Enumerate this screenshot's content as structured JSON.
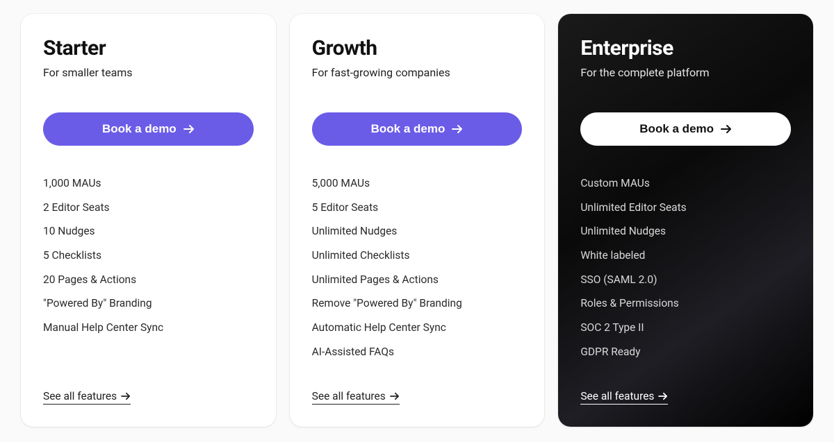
{
  "plans": [
    {
      "title": "Starter",
      "subtitle": "For smaller teams",
      "cta": "Book a demo",
      "features": [
        "1,000 MAUs",
        "2 Editor Seats",
        "10 Nudges",
        "5 Checklists",
        "20 Pages & Actions",
        "\"Powered By\" Branding",
        "Manual Help Center Sync"
      ],
      "see_all": "See all features"
    },
    {
      "title": "Growth",
      "subtitle": "For fast-growing companies",
      "cta": "Book a demo",
      "features": [
        "5,000 MAUs",
        "5 Editor Seats",
        "Unlimited Nudges",
        "Unlimited Checklists",
        "Unlimited Pages & Actions",
        "Remove \"Powered By\" Branding",
        "Automatic Help Center Sync",
        "AI-Assisted FAQs"
      ],
      "see_all": "See all features"
    },
    {
      "title": "Enterprise",
      "subtitle": "For the complete platform",
      "cta": "Book a demo",
      "features": [
        "Custom MAUs",
        "Unlimited Editor Seats",
        "Unlimited Nudges",
        "White labeled",
        "SSO (SAML 2.0)",
        "Roles & Permissions",
        "SOC 2 Type II",
        "GDPR Ready"
      ],
      "see_all": "See all features"
    }
  ]
}
